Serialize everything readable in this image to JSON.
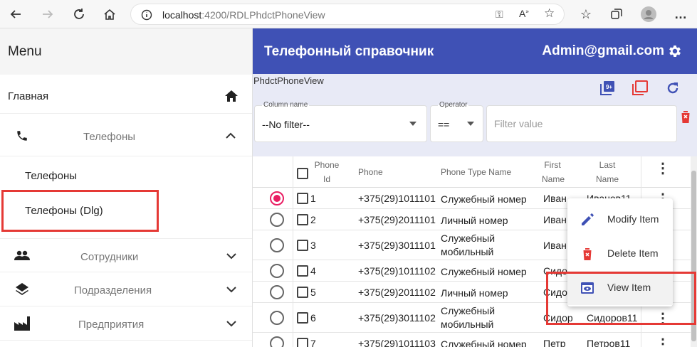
{
  "browser": {
    "url_host": "localhost",
    "url_path": ":4200/RDLPhdctPhoneView"
  },
  "sidebar": {
    "title": "Menu",
    "home": "Главная",
    "phones_group": "Телефоны",
    "sub_items": [
      "Телефоны",
      "Телефоны (Dlg)"
    ],
    "employees": "Сотрудники",
    "departments": "Подразделения",
    "enterprises": "Предприятия"
  },
  "header": {
    "title": "Телефонный справочник",
    "user": "Admin@gmail.com"
  },
  "view": {
    "name": "PhdctPhoneView"
  },
  "filter": {
    "column_label": "Column name",
    "column_value": "--No filter--",
    "op_label": "Operator",
    "op_value": "==",
    "value_placeholder": "Filter value"
  },
  "table": {
    "headers": {
      "phone_id_1": "Phone",
      "phone_id_2": "Id",
      "phone": "Phone",
      "type": "Phone Type Name",
      "first_1": "First",
      "first_2": "Name",
      "last_1": "Last",
      "last_2": "Name"
    },
    "rows": [
      {
        "id": "1",
        "phone": "+375(29)1011101",
        "type1": "Служебный номер",
        "type2": "",
        "first": "Иван",
        "last": "Иванов11"
      },
      {
        "id": "2",
        "phone": "+375(29)2011101",
        "type1": "Личный номер",
        "type2": "",
        "first": "Иван",
        "last": ""
      },
      {
        "id": "3",
        "phone": "+375(29)3011101",
        "type1": "Служебный",
        "type2": "мобильный",
        "first": "Иван",
        "last": ""
      },
      {
        "id": "4",
        "phone": "+375(29)1011102",
        "type1": "Служебный номер",
        "type2": "",
        "first": "Сидо",
        "last": ""
      },
      {
        "id": "5",
        "phone": "+375(29)2011102",
        "type1": "Личный номер",
        "type2": "",
        "first": "Сидо",
        "last": ""
      },
      {
        "id": "6",
        "phone": "+375(29)3011102",
        "type1": "Служебный",
        "type2": "мобильный",
        "first": "Сидор",
        "last": "Сидоров11"
      },
      {
        "id": "7",
        "phone": "+375(29)1011103",
        "type1": "Служебный номер",
        "type2": "",
        "first": "Петр",
        "last": "Петров11"
      }
    ]
  },
  "context_menu": {
    "items": [
      "Modify Item",
      "Delete Item",
      "View Item"
    ]
  },
  "colors": {
    "primary": "#3f51b5",
    "accent": "#e91e63",
    "warn": "#e53935",
    "panel": "#e8eaf6"
  }
}
